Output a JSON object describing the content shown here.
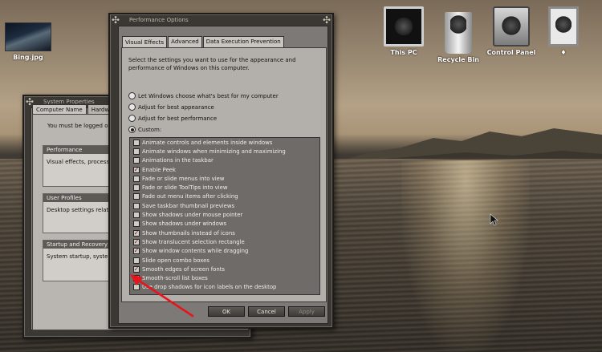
{
  "desktop": {
    "icons": [
      {
        "label": "Bing.jpg"
      },
      {
        "label": "This PC"
      },
      {
        "label": "Recycle Bin"
      },
      {
        "label": "Control Panel"
      },
      {
        "label": "♦"
      }
    ]
  },
  "system_properties": {
    "title": "System Properties",
    "tabs": [
      "Computer Name",
      "Hardwa"
    ],
    "intro": "You must be logged on as",
    "groups": [
      {
        "title": "Performance",
        "text": "Visual effects, processor"
      },
      {
        "title": "User Profiles",
        "text": "Desktop settings related t"
      },
      {
        "title": "Startup and Recovery",
        "text": "System startup, system fai"
      }
    ]
  },
  "performance_options": {
    "title": "Performance Options",
    "tabs": [
      "Visual Effects",
      "Advanced",
      "Data Execution Prevention"
    ],
    "intro": "Select the settings you want to use for the appearance and performance of Windows on this computer.",
    "radios": [
      {
        "label": "Let Windows choose what's best for my computer",
        "selected": false
      },
      {
        "label": "Adjust for best appearance",
        "selected": false
      },
      {
        "label": "Adjust for best performance",
        "selected": false
      },
      {
        "label": "Custom:",
        "selected": true
      }
    ],
    "options": [
      {
        "label": "Animate controls and elements inside windows",
        "checked": false
      },
      {
        "label": "Animate windows when minimizing and maximizing",
        "checked": false
      },
      {
        "label": "Animations in the taskbar",
        "checked": false
      },
      {
        "label": "Enable Peek",
        "checked": true
      },
      {
        "label": "Fade or slide menus into view",
        "checked": false
      },
      {
        "label": "Fade or slide ToolTips into view",
        "checked": false
      },
      {
        "label": "Fade out menu items after clicking",
        "checked": false
      },
      {
        "label": "Save taskbar thumbnail previews",
        "checked": false
      },
      {
        "label": "Show shadows under mouse pointer",
        "checked": false
      },
      {
        "label": "Show shadows under windows",
        "checked": false
      },
      {
        "label": "Show thumbnails instead of icons",
        "checked": true
      },
      {
        "label": "Show translucent selection rectangle",
        "checked": true
      },
      {
        "label": "Show window contents while dragging",
        "checked": true
      },
      {
        "label": "Slide open combo boxes",
        "checked": false
      },
      {
        "label": "Smooth edges of screen fonts",
        "checked": true
      },
      {
        "label": "Smooth-scroll list boxes",
        "checked": true
      },
      {
        "label": "Use drop shadows for icon labels on the desktop",
        "checked": false
      }
    ],
    "buttons": {
      "ok": "OK",
      "cancel": "Cancel",
      "apply": "Apply"
    }
  },
  "colors": {
    "annotation_arrow": "#e8141c",
    "check_mark": "#7a1d1d"
  }
}
